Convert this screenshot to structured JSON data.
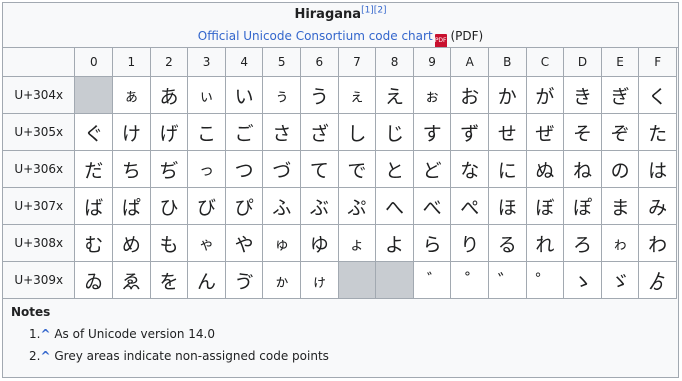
{
  "header": {
    "title": "Hiragana",
    "refs": "[1][2]",
    "chart_link": "Official Unicode Consortium code chart",
    "pdf_badge": "PDF",
    "pdf_suffix": "(PDF)"
  },
  "columns": [
    "0",
    "1",
    "2",
    "3",
    "4",
    "5",
    "6",
    "7",
    "8",
    "9",
    "A",
    "B",
    "C",
    "D",
    "E",
    "F"
  ],
  "rows": [
    {
      "label": "U+304x",
      "cells": [
        "",
        "ぁ",
        "あ",
        "ぃ",
        "い",
        "ぅ",
        "う",
        "ぇ",
        "え",
        "ぉ",
        "お",
        "か",
        "が",
        "き",
        "ぎ",
        "く"
      ]
    },
    {
      "label": "U+305x",
      "cells": [
        "ぐ",
        "け",
        "げ",
        "こ",
        "ご",
        "さ",
        "ざ",
        "し",
        "じ",
        "す",
        "ず",
        "せ",
        "ぜ",
        "そ",
        "ぞ",
        "た"
      ]
    },
    {
      "label": "U+306x",
      "cells": [
        "だ",
        "ち",
        "ぢ",
        "っ",
        "つ",
        "づ",
        "て",
        "で",
        "と",
        "ど",
        "な",
        "に",
        "ぬ",
        "ね",
        "の",
        "は"
      ]
    },
    {
      "label": "U+307x",
      "cells": [
        "ば",
        "ぱ",
        "ひ",
        "び",
        "ぴ",
        "ふ",
        "ぶ",
        "ぷ",
        "へ",
        "べ",
        "ぺ",
        "ほ",
        "ぼ",
        "ぽ",
        "ま",
        "み"
      ]
    },
    {
      "label": "U+308x",
      "cells": [
        "む",
        "め",
        "も",
        "ゃ",
        "や",
        "ゅ",
        "ゆ",
        "ょ",
        "よ",
        "ら",
        "り",
        "る",
        "れ",
        "ろ",
        "ゎ",
        "わ"
      ]
    },
    {
      "label": "U+309x",
      "cells": [
        "ゐ",
        "ゑ",
        "を",
        "ん",
        "ゔ",
        "ゕ",
        "ゖ",
        "",
        "",
        "゙",
        "゚",
        "゛",
        "゜",
        "ゝ",
        "ゞ",
        "ゟ"
      ]
    }
  ],
  "unassigned": [
    [
      0,
      0
    ],
    [
      5,
      7
    ],
    [
      5,
      8
    ]
  ],
  "small_kana": [
    [
      0,
      1
    ],
    [
      0,
      3
    ],
    [
      0,
      5
    ],
    [
      0,
      7
    ],
    [
      0,
      9
    ],
    [
      2,
      3
    ],
    [
      4,
      3
    ],
    [
      4,
      5
    ],
    [
      4,
      7
    ],
    [
      4,
      14
    ],
    [
      5,
      5
    ],
    [
      5,
      6
    ]
  ],
  "notes": {
    "heading": "Notes",
    "items": [
      {
        "num": "1.",
        "caret": "^",
        "text": "As of Unicode version 14.0"
      },
      {
        "num": "2.",
        "caret": "^",
        "text": "Grey areas indicate non-assigned code points"
      }
    ]
  },
  "colors": {
    "link": "#3366cc",
    "unassigned": "#c8ccd1",
    "border": "#a2a9b1",
    "header_bg": "#f8f9fa"
  }
}
